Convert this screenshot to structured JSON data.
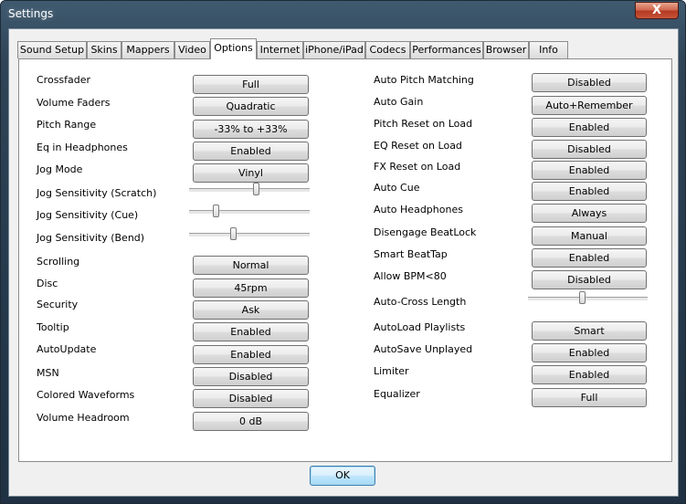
{
  "window": {
    "title": "Settings",
    "close_symbol": "X"
  },
  "tabs": [
    "Sound Setup",
    "Skins",
    "Mappers",
    "Video",
    "Options",
    "Internet",
    "iPhone/iPad",
    "Codecs",
    "Performances",
    "Browser",
    "Info"
  ],
  "active_tab": "Options",
  "left_options": [
    {
      "label": "Crossfader",
      "value": "Full"
    },
    {
      "label": "Volume Faders",
      "value": "Quadratic"
    },
    {
      "label": "Pitch Range",
      "value": "-33% to +33%"
    },
    {
      "label": "Eq in Headphones",
      "value": "Enabled"
    },
    {
      "label": "Jog Mode",
      "value": "Vinyl"
    },
    {
      "label": "Jog Sensitivity (Scratch)",
      "slider": 0.55
    },
    {
      "label": "Jog Sensitivity (Cue)",
      "slider": 0.22
    },
    {
      "label": "Jog Sensitivity (Bend)",
      "slider": 0.36
    },
    {
      "label": "Scrolling",
      "value": "Normal"
    },
    {
      "label": "Disc",
      "value": "45rpm"
    },
    {
      "label": "Security",
      "value": "Ask"
    },
    {
      "label": "Tooltip",
      "value": "Enabled"
    },
    {
      "label": "AutoUpdate",
      "value": "Enabled"
    },
    {
      "label": "MSN",
      "value": "Disabled"
    },
    {
      "label": "Colored Waveforms",
      "value": "Disabled"
    },
    {
      "label": "Volume Headroom",
      "value": "0 dB"
    }
  ],
  "right_options": [
    {
      "label": "Auto Pitch Matching",
      "value": "Disabled"
    },
    {
      "label": "Auto Gain",
      "value": "Auto+Remember"
    },
    {
      "label": "Pitch Reset on Load",
      "value": "Enabled"
    },
    {
      "label": "EQ Reset on Load",
      "value": "Disabled"
    },
    {
      "label": "FX Reset on Load",
      "value": "Enabled"
    },
    {
      "label": "Auto Cue",
      "value": "Enabled"
    },
    {
      "label": "Auto Headphones",
      "value": "Always"
    },
    {
      "label": "Disengage BeatLock",
      "value": "Manual"
    },
    {
      "label": "Smart BeatTap",
      "value": "Enabled"
    },
    {
      "label": "Allow BPM<80",
      "value": "Disabled"
    },
    {
      "label": "Auto-Cross Length",
      "slider": 0.45
    },
    {
      "label": "AutoLoad Playlists",
      "value": "Smart"
    },
    {
      "label": "AutoSave Unplayed",
      "value": "Enabled"
    },
    {
      "label": "Limiter",
      "value": "Enabled"
    },
    {
      "label": "Equalizer",
      "value": "Full"
    }
  ],
  "ok_label": "OK"
}
